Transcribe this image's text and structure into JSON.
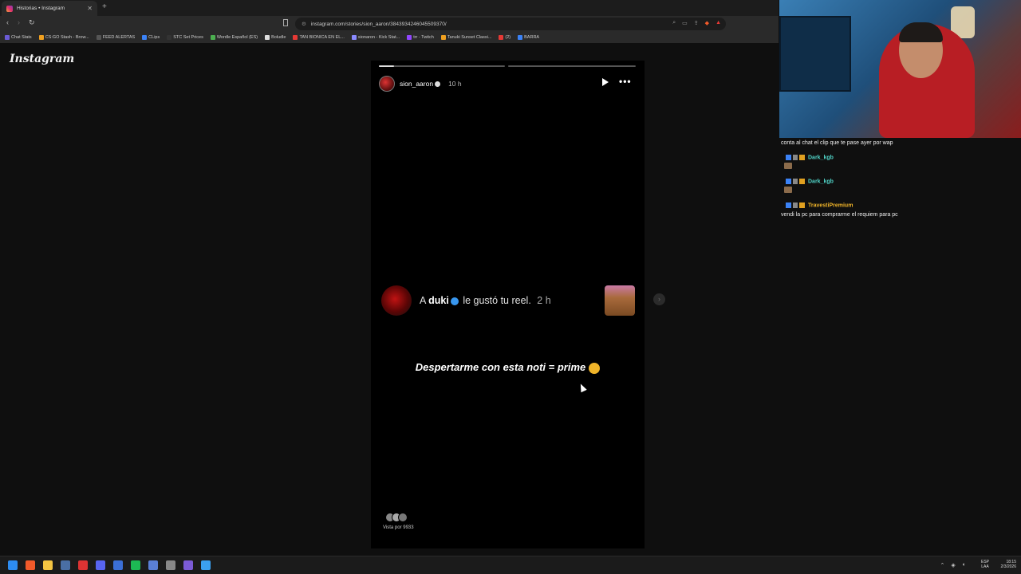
{
  "browser": {
    "tab_title": "Historias • Instagram",
    "new_tab": "+",
    "url": "instagram.com/stories/sion_aaron/3843934246045509370/",
    "bookmarks": [
      {
        "label": "Chat Stats",
        "color": "#6b5bd6"
      },
      {
        "label": "CS:GO Stash - Brow...",
        "color": "#f0a020"
      },
      {
        "label": "FEED ALERTAS",
        "color": "#555"
      },
      {
        "label": "CLips",
        "color": "#3b82f6"
      },
      {
        "label": "STC Set Prices",
        "color": "#333"
      },
      {
        "label": "Wordle Español (ES)",
        "color": "#4caf50"
      },
      {
        "label": "Boludle",
        "color": "#ddd"
      },
      {
        "label": "TAN BIONICA EN EL...",
        "color": "#e53935"
      },
      {
        "label": "sionaron - Kick Stat...",
        "color": "#8a8aff"
      },
      {
        "label": "trr - Twitch",
        "color": "#9146ff"
      },
      {
        "label": "Tanuki Sunset Classi...",
        "color": "#f0a020"
      },
      {
        "label": "(2)",
        "color": "#e53935"
      },
      {
        "label": "BARRA",
        "color": "#3b82f6"
      }
    ]
  },
  "instagram": {
    "logo": "Instagram",
    "story": {
      "username": "sion_aaron",
      "time": "10 h",
      "progress_total": 2,
      "progress_current": 0.12,
      "notification": {
        "prefix": "A",
        "actor": "duki",
        "action": "le gustó tu reel.",
        "time": "2 h"
      },
      "caption": "Despertarme con esta noti = prime",
      "viewed_by": "Vista por 9933"
    }
  },
  "chat": {
    "lines": [
      {
        "type": "message",
        "text": "conta al chat el clip que te pase ayer por wap"
      },
      {
        "type": "user",
        "user": "Dark_kgb",
        "color": "#4fd1c5"
      },
      {
        "type": "user",
        "user": "Dark_kgb",
        "color": "#4fd1c5"
      },
      {
        "type": "user",
        "user": "TravestiPremium",
        "color": "#f0b429"
      },
      {
        "type": "message",
        "text": "vendi la pc para comprarme el requiem para pc"
      }
    ]
  },
  "taskbar": {
    "lang_top": "ESP",
    "lang_bottom": "LAA",
    "time": "18:15",
    "date": "2/3/2026",
    "icons": [
      {
        "name": "windows-start-icon",
        "color": "#2d8cf0"
      },
      {
        "name": "brave-icon",
        "color": "#f25a2a"
      },
      {
        "name": "file-explorer-icon",
        "color": "#f4c542"
      },
      {
        "name": "steam-icon",
        "color": "#4a6fa5"
      },
      {
        "name": "chrome-icon",
        "color": "#d33"
      },
      {
        "name": "discord-icon",
        "color": "#5865f2"
      },
      {
        "name": "app-icon",
        "color": "#3b6fd6"
      },
      {
        "name": "spotify-icon",
        "color": "#1db954"
      },
      {
        "name": "app-icon-2",
        "color": "#5a7fd6"
      },
      {
        "name": "app-icon-3",
        "color": "#888"
      },
      {
        "name": "app-icon-4",
        "color": "#7b5bd6"
      },
      {
        "name": "app-icon-5",
        "color": "#3ba0f0"
      }
    ]
  }
}
